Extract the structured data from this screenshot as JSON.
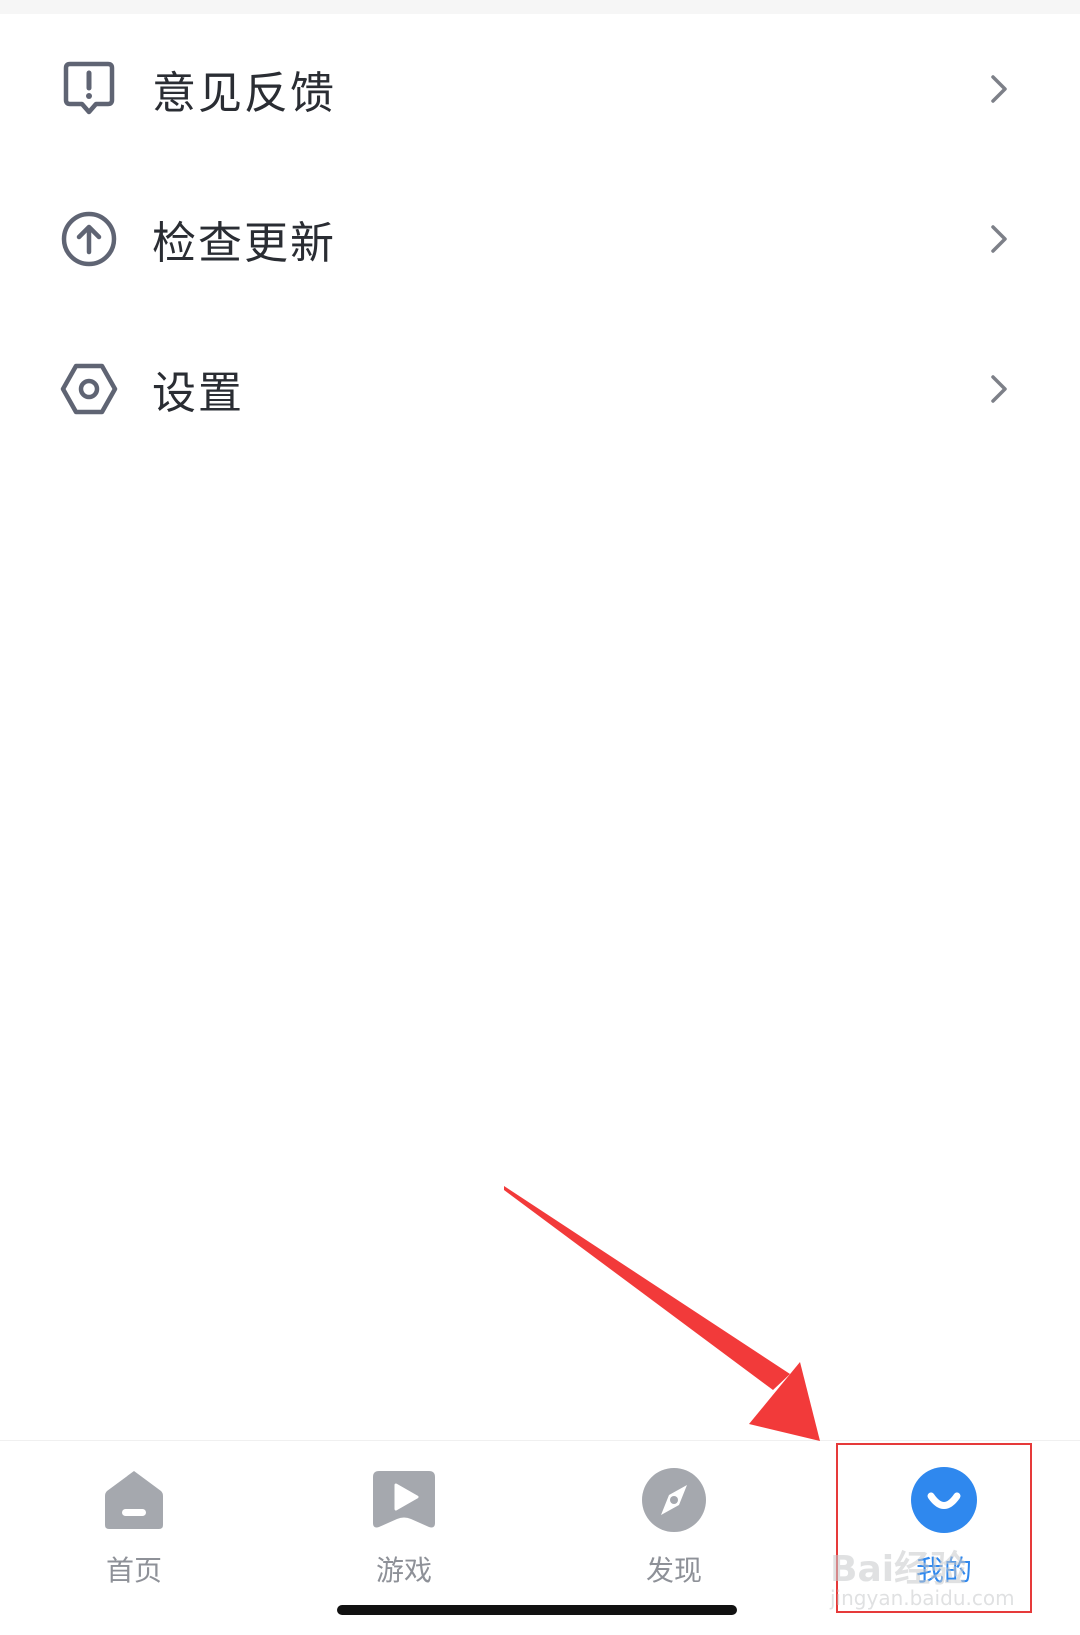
{
  "menu": {
    "items": [
      {
        "label": "意见反馈",
        "icon": "feedback-icon"
      },
      {
        "label": "检查更新",
        "icon": "update-icon"
      },
      {
        "label": "设置",
        "icon": "settings-icon"
      }
    ]
  },
  "tabbar": {
    "tabs": [
      {
        "label": "首页",
        "icon": "home-icon",
        "active": false
      },
      {
        "label": "游戏",
        "icon": "game-icon",
        "active": false
      },
      {
        "label": "发现",
        "icon": "discover-icon",
        "active": false
      },
      {
        "label": "我的",
        "icon": "profile-icon",
        "active": true
      }
    ]
  },
  "watermark": {
    "brand": "Bai经验",
    "url": "jingyan.baidu.com"
  },
  "colors": {
    "accent": "#2f88ee",
    "icon_gray": "#5f6473",
    "tab_gray": "#a5a8ae",
    "annotation_red": "#e63a3a"
  }
}
